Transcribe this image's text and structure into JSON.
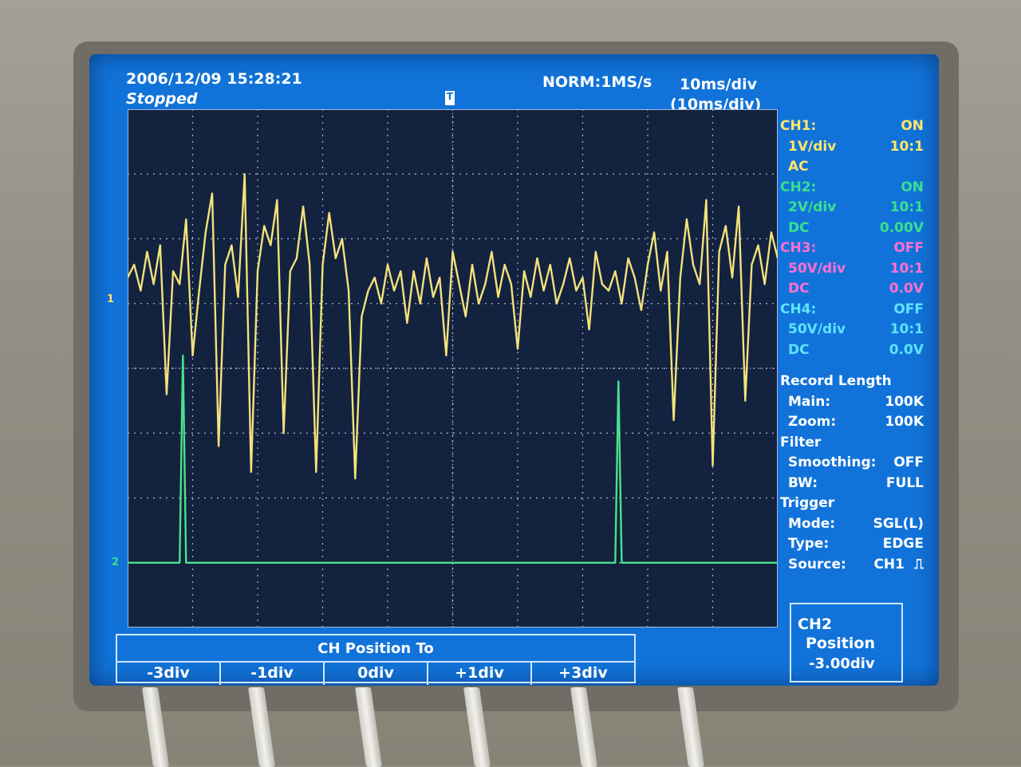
{
  "header": {
    "datetime": "2006/12/09  15:28:21",
    "status": "Stopped",
    "acquisition": "NORM:1MS/s",
    "timebase": "10ms/div",
    "zoom_timebase": "(10ms/div)",
    "trigger_marker": "T"
  },
  "channels": [
    {
      "name": "CH1:",
      "state": "ON",
      "scale": "1V/div",
      "probe": "10:1",
      "coupling": "AC",
      "offset": "",
      "color": "#ffe66b"
    },
    {
      "name": "CH2:",
      "state": "ON",
      "scale": "2V/div",
      "probe": "10:1",
      "coupling": "DC",
      "offset": "0.00V",
      "color": "#39e08f"
    },
    {
      "name": "CH3:",
      "state": "OFF",
      "scale": "50V/div",
      "probe": "10:1",
      "coupling": "DC",
      "offset": "0.0V",
      "color": "#ff6fcf"
    },
    {
      "name": "CH4:",
      "state": "OFF",
      "scale": "50V/div",
      "probe": "10:1",
      "coupling": "DC",
      "offset": "0.0V",
      "color": "#5fe3ff"
    }
  ],
  "record": {
    "title": "Record Length",
    "main_label": "Main:",
    "main_value": "100K",
    "zoom_label": "Zoom:",
    "zoom_value": "100K"
  },
  "filter": {
    "title": "Filter",
    "smoothing_label": "Smoothing:",
    "smoothing_value": "OFF",
    "bw_label": "BW:",
    "bw_value": "FULL"
  },
  "trigger": {
    "title": "Trigger",
    "mode_label": "Mode:",
    "mode_value": "SGL(L)",
    "type_label": "Type:",
    "type_value": "EDGE",
    "source_label": "Source:",
    "source_value": "CH1",
    "slope_icon": "rising-edge-icon"
  },
  "softkeys": {
    "title": "CH Position To",
    "buttons": [
      "-3div",
      "-1div",
      "0div",
      "+1div",
      "+3div"
    ]
  },
  "position_box": {
    "line1": "CH2",
    "line2": "Position",
    "line3": "-3.00div"
  },
  "ground_markers": {
    "ch1": "1",
    "ch2": "2"
  },
  "colors": {
    "screen_bg": "#1173d9",
    "plot_bg": "#13223f",
    "grid": "#aab7d4",
    "ch1_trace": "#f3e27a",
    "ch2_trace": "#46e38d"
  },
  "chart_data": {
    "type": "line",
    "title": "",
    "xlabel": "",
    "ylabel": "",
    "x_divisions": 10,
    "y_divisions": 8,
    "xlim": [
      0,
      10
    ],
    "ylim": [
      -4,
      4
    ],
    "grid": true,
    "series": [
      {
        "name": "CH1",
        "color": "#f3e27a",
        "x": [
          0,
          0.1,
          0.2,
          0.3,
          0.4,
          0.5,
          0.6,
          0.7,
          0.8,
          0.9,
          1.0,
          1.1,
          1.2,
          1.3,
          1.4,
          1.5,
          1.6,
          1.7,
          1.8,
          1.9,
          2.0,
          2.1,
          2.2,
          2.3,
          2.4,
          2.5,
          2.6,
          2.7,
          2.8,
          2.9,
          3.0,
          3.1,
          3.2,
          3.3,
          3.4,
          3.5,
          3.6,
          3.7,
          3.8,
          3.9,
          4.0,
          4.1,
          4.2,
          4.3,
          4.4,
          4.5,
          4.6,
          4.7,
          4.8,
          4.9,
          5.0,
          5.1,
          5.2,
          5.3,
          5.4,
          5.5,
          5.6,
          5.7,
          5.8,
          5.9,
          6.0,
          6.1,
          6.2,
          6.3,
          6.4,
          6.5,
          6.6,
          6.7,
          6.8,
          6.9,
          7.0,
          7.1,
          7.2,
          7.3,
          7.4,
          7.5,
          7.6,
          7.7,
          7.8,
          7.9,
          8.0,
          8.1,
          8.2,
          8.3,
          8.4,
          8.5,
          8.6,
          8.7,
          8.8,
          8.9,
          9.0,
          9.1,
          9.2,
          9.3,
          9.4,
          9.5,
          9.6,
          9.7,
          9.8,
          9.9,
          10.0
        ],
        "values": [
          1.4,
          1.6,
          1.2,
          1.8,
          1.3,
          1.9,
          -0.4,
          1.5,
          1.3,
          2.3,
          0.2,
          1.2,
          2.1,
          2.7,
          -1.2,
          1.6,
          1.9,
          1.1,
          3.0,
          -1.6,
          1.5,
          2.2,
          1.9,
          2.6,
          -1.0,
          1.5,
          1.7,
          2.5,
          1.6,
          -1.6,
          1.6,
          2.4,
          1.7,
          2.0,
          1.2,
          -1.7,
          0.8,
          1.2,
          1.4,
          1.0,
          1.6,
          1.2,
          1.5,
          0.7,
          1.5,
          1.0,
          1.7,
          1.1,
          1.4,
          0.2,
          1.8,
          1.3,
          0.8,
          1.6,
          1.0,
          1.3,
          1.8,
          1.1,
          1.6,
          1.3,
          0.3,
          1.5,
          1.1,
          1.7,
          1.2,
          1.6,
          1.0,
          1.3,
          1.7,
          1.2,
          1.4,
          0.6,
          1.8,
          1.3,
          1.2,
          1.5,
          1.0,
          1.7,
          1.4,
          0.9,
          1.6,
          2.1,
          1.2,
          1.8,
          -0.8,
          1.4,
          2.3,
          1.6,
          1.3,
          2.6,
          -1.5,
          1.8,
          2.2,
          1.4,
          2.5,
          -0.5,
          1.6,
          1.9,
          1.3,
          2.1,
          1.7
        ]
      },
      {
        "name": "CH2",
        "color": "#46e38d",
        "x": [
          0,
          0.5,
          0.8,
          0.85,
          0.9,
          1.0,
          1.5,
          2.0,
          2.5,
          3.0,
          3.5,
          4.0,
          4.5,
          5.0,
          5.5,
          6.0,
          6.5,
          7.0,
          7.5,
          7.55,
          7.6,
          8.0,
          8.5,
          9.0,
          9.5,
          10.0
        ],
        "values": [
          -3.0,
          -3.0,
          -3.0,
          0.2,
          -3.0,
          -3.0,
          -3.0,
          -3.0,
          -3.0,
          -3.0,
          -3.0,
          -3.0,
          -3.0,
          -3.0,
          -3.0,
          -3.0,
          -3.0,
          -3.0,
          -3.0,
          -0.2,
          -3.0,
          -3.0,
          -3.0,
          -3.0,
          -3.0,
          -3.0
        ]
      }
    ]
  }
}
